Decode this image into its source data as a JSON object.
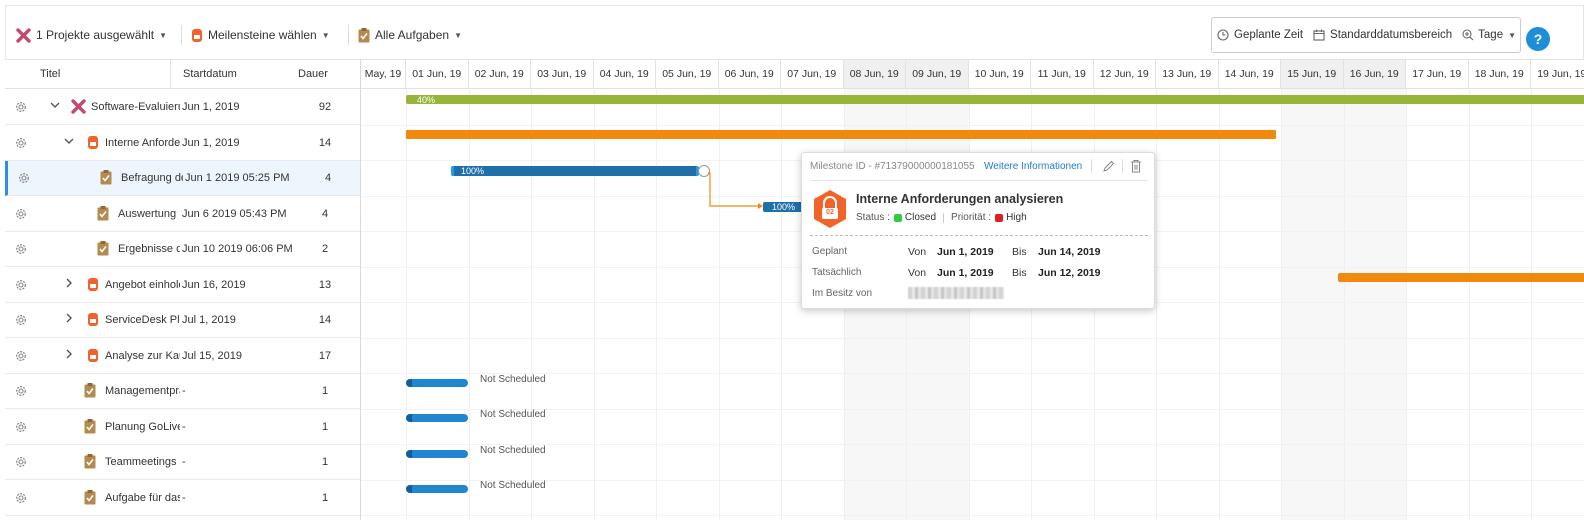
{
  "toolbar": {
    "projects_label": "1 Projekte ausgewählt",
    "milestones_label": "Meilensteine wählen",
    "tasks_label": "Alle Aufgaben",
    "planned_time_label": "Geplante Zeit",
    "date_range_label": "Standarddatumsbereich",
    "zoom_label": "Tage",
    "help_label": "?"
  },
  "columns": {
    "title": "Titel",
    "start": "Startdatum",
    "duration": "Dauer"
  },
  "timeline_dates": [
    "May, 19",
    "01 Jun, 19",
    "02 Jun, 19",
    "03 Jun, 19",
    "04 Jun, 19",
    "05 Jun, 19",
    "06 Jun, 19",
    "07 Jun, 19",
    "08 Jun, 19",
    "09 Jun, 19",
    "10 Jun, 19",
    "11 Jun, 19",
    "12 Jun, 19",
    "13 Jun, 19",
    "14 Jun, 19",
    "15 Jun, 19",
    "16 Jun, 19",
    "17 Jun, 19",
    "18 Jun, 19",
    "19 Jun, 19"
  ],
  "rows": [
    {
      "title": "Software-Evaluierung",
      "start": "Jun 1, 2019",
      "duration": "92",
      "icon": "project-icon",
      "expander": "expanded"
    },
    {
      "title": "Interne Anforderungen analysieren",
      "start": "Jun 1, 2019",
      "duration": "14",
      "icon": "milestone-icon",
      "expander": "expanded"
    },
    {
      "title": "Befragung der Anwender",
      "start": "Jun 1 2019 05:25 PM",
      "duration": "4",
      "icon": "task-icon",
      "expander": "none"
    },
    {
      "title": "Auswertung",
      "start": "Jun 6 2019 05:43 PM",
      "duration": "4",
      "icon": "task-icon",
      "expander": "none"
    },
    {
      "title": "Ergebnisse dokumentieren",
      "start": "Jun 10 2019 06:06 PM",
      "duration": "2",
      "icon": "task-icon",
      "expander": "none"
    },
    {
      "title": "Angebot einholen",
      "start": "Jun 16, 2019",
      "duration": "13",
      "icon": "milestone-icon",
      "expander": "collapsed"
    },
    {
      "title": "ServiceDesk Plus",
      "start": "Jul 1, 2019",
      "duration": "14",
      "icon": "milestone-icon",
      "expander": "collapsed"
    },
    {
      "title": "Analyse zur Kaufentscheidung",
      "start": "Jul 15, 2019",
      "duration": "17",
      "icon": "milestone-icon",
      "expander": "collapsed"
    },
    {
      "title": "Managementpräsentation",
      "start": "-",
      "duration": "1",
      "icon": "task-icon",
      "expander": "none"
    },
    {
      "title": "Planung GoLive",
      "start": "-",
      "duration": "1",
      "icon": "task-icon",
      "expander": "none"
    },
    {
      "title": "Teammeetings Planen",
      "start": "-",
      "duration": "1",
      "icon": "task-icon",
      "expander": "none"
    },
    {
      "title": "Aufgabe für das Team",
      "start": "-",
      "duration": "1",
      "icon": "task-icon",
      "expander": "none"
    }
  ],
  "bars": {
    "project_progress": "40%",
    "task1_progress": "100%",
    "task2_progress": "100%",
    "not_scheduled": "Not Scheduled"
  },
  "popup": {
    "milestone_id": "Milestone ID - #71379000000181055",
    "more_info": "Weitere Informationen",
    "badge": "02",
    "title": "Interne Anforderungen analysieren",
    "status_label": "Status :",
    "status_value": "Closed",
    "priority_label": "Priorität :",
    "priority_value": "High",
    "planned_label": "Geplant",
    "actual_label": "Tatsächlich",
    "owner_label": "Im Besitz von",
    "from_label": "Von",
    "to_label": "Bis",
    "planned_from": "Jun 1, 2019",
    "planned_to": "Jun 14, 2019",
    "actual_from": "Jun 1, 2019",
    "actual_to": "Jun 12, 2019"
  },
  "colors": {
    "project_bar": "#97b53a",
    "milestone_bar": "#f08a0f",
    "task_bar": "#1f6fa8",
    "unscheduled_bar": "#1f86cf",
    "accent": "#1f8ed8",
    "status_closed": "#2ecc40",
    "priority_high": "#e01e1e"
  }
}
